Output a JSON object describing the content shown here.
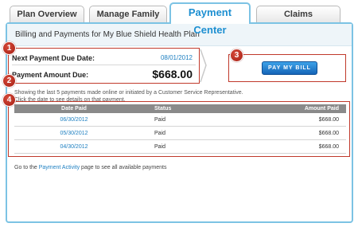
{
  "tabs": [
    {
      "label": "Plan Overview"
    },
    {
      "label": "Manage Family"
    },
    {
      "label": "Payment Center"
    },
    {
      "label": "Claims"
    }
  ],
  "panel": {
    "title": "Billing and Payments for My Blue Shield Health Plan"
  },
  "summary": {
    "next_due_label": "Next Payment Due Date:",
    "next_due_value": "08/01/2012",
    "amount_label": "Payment Amount Due:",
    "amount_value": "$668.00"
  },
  "pay_button": {
    "label": "PAY MY BILL"
  },
  "notes": {
    "line1": "Showing the last 5 payments made online or initiated by a Customer Service Representative.",
    "line2": "Click the date to see details on that payment."
  },
  "table": {
    "headers": [
      "Date Paid",
      "Status",
      "Amount Paid"
    ],
    "rows": [
      {
        "date": "06/30/2012",
        "status": "Paid",
        "amount": "$668.00"
      },
      {
        "date": "05/30/2012",
        "status": "Paid",
        "amount": "$668.00"
      },
      {
        "date": "04/30/2012",
        "status": "Paid",
        "amount": "$668.00"
      }
    ]
  },
  "footer": {
    "prefix": "Go to the ",
    "link": "Payment Activity",
    "suffix": " page to see all available payments"
  },
  "callouts": [
    "1",
    "2",
    "3",
    "4"
  ],
  "colors": {
    "accent": "#1d8fd1",
    "callout": "#c0392b",
    "link": "#1d7fc1"
  }
}
